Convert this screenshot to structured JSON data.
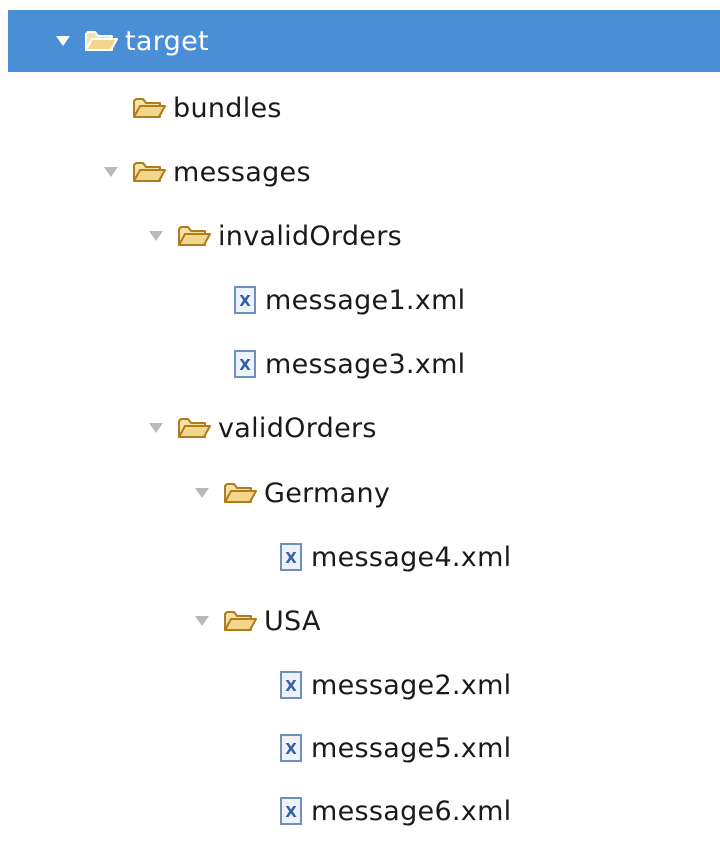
{
  "tree": {
    "items": [
      {
        "label": "target",
        "type": "folder",
        "expanded": true,
        "selected": true
      },
      {
        "label": "bundles",
        "type": "folder",
        "expanded": false
      },
      {
        "label": "messages",
        "type": "folder",
        "expanded": true
      },
      {
        "label": "invalidOrders",
        "type": "folder",
        "expanded": true
      },
      {
        "label": "message1.xml",
        "type": "xml-file"
      },
      {
        "label": "message3.xml",
        "type": "xml-file"
      },
      {
        "label": "validOrders",
        "type": "folder",
        "expanded": true
      },
      {
        "label": "Germany",
        "type": "folder",
        "expanded": true
      },
      {
        "label": "message4.xml",
        "type": "xml-file"
      },
      {
        "label": "USA",
        "type": "folder",
        "expanded": true
      },
      {
        "label": "message2.xml",
        "type": "xml-file"
      },
      {
        "label": "message5.xml",
        "type": "xml-file"
      },
      {
        "label": "message6.xml",
        "type": "xml-file"
      }
    ],
    "xml_icon_letter": "X"
  },
  "colors": {
    "selection": "#4a8fd6",
    "folder_fill": "#f3d58c",
    "folder_stroke": "#b07a1e",
    "xml_icon_letter": "#2f5fa8"
  }
}
